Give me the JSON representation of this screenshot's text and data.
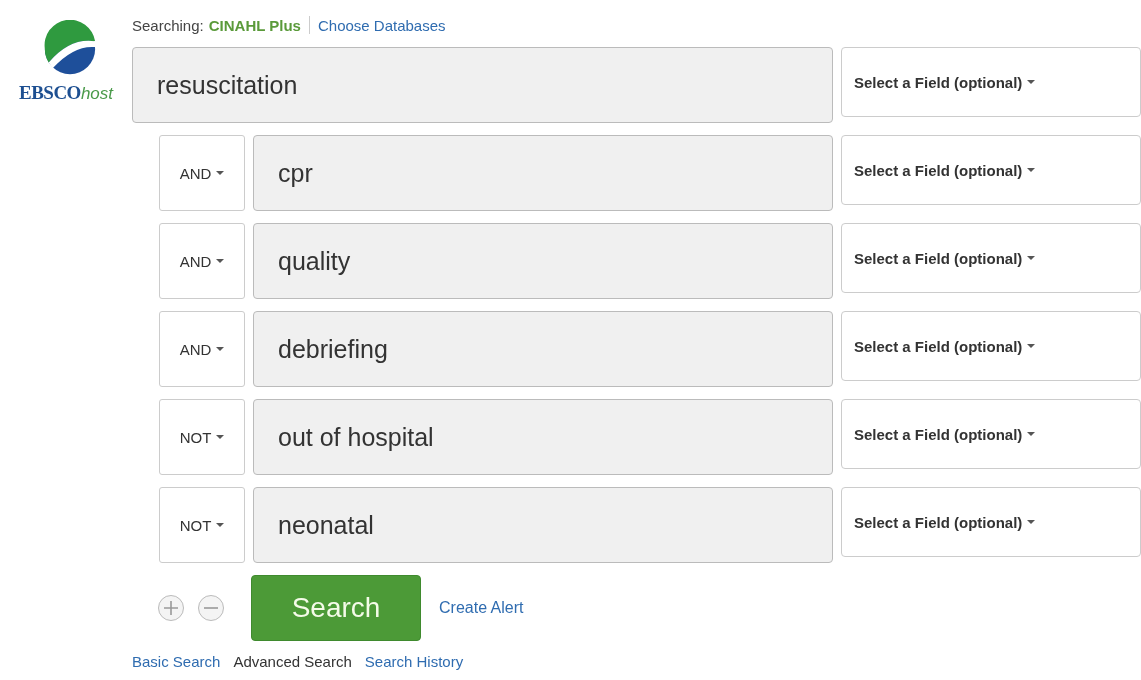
{
  "logo": {
    "brand": "EBSCO",
    "suffix": "host"
  },
  "searching": {
    "label": "Searching:",
    "database": "CINAHL Plus",
    "link": "Choose Databases"
  },
  "rows": [
    {
      "operator": null,
      "term": "resuscitation",
      "field": "Select a Field (optional)"
    },
    {
      "operator": "AND",
      "term": "cpr",
      "field": "Select a Field (optional)"
    },
    {
      "operator": "AND",
      "term": "quality",
      "field": "Select a Field (optional)"
    },
    {
      "operator": "AND",
      "term": "debriefing",
      "field": "Select a Field (optional)"
    },
    {
      "operator": "NOT",
      "term": "out of hospital",
      "field": "Select a Field (optional)"
    },
    {
      "operator": "NOT",
      "term": "neonatal",
      "field": "Select a Field (optional)"
    }
  ],
  "search_button": "Search",
  "create_alert": "Create Alert",
  "nav_links": [
    {
      "label": "Basic Search",
      "selected": false
    },
    {
      "label": "Advanced Search",
      "selected": true
    },
    {
      "label": "Search History",
      "selected": false
    }
  ]
}
